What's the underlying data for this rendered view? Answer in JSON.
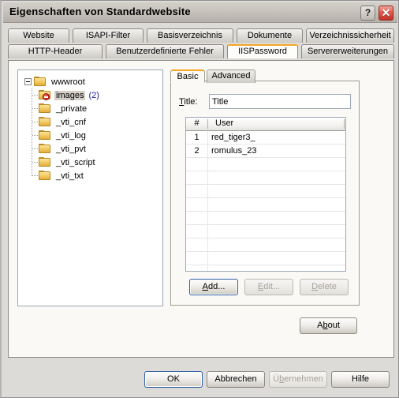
{
  "window": {
    "title": "Eigenschaften von Standardwebsite",
    "help_button": "?",
    "close_button": "✕"
  },
  "colors": {
    "accent_orange": "#f5a623",
    "dialog_face": "#dcdbd8",
    "panel_background": "#faf9f5",
    "tree_count_blue": "#1a1aa8",
    "selection_gray": "#d4d0c8",
    "close_red": "#c23227"
  },
  "outer_tabs": {
    "row1": [
      {
        "label": "Website",
        "active": false
      },
      {
        "label": "ISAPI-Filter",
        "active": false
      },
      {
        "label": "Basisverzeichnis",
        "active": false
      },
      {
        "label": "Dokumente",
        "active": false
      },
      {
        "label": "Verzeichnissicherheit",
        "active": false
      }
    ],
    "row2": [
      {
        "label": "HTTP-Header",
        "active": false
      },
      {
        "label": "Benutzerdefinierte Fehler",
        "active": false
      },
      {
        "label": "IISPassword",
        "active": true
      },
      {
        "label": "Servererweiterungen",
        "active": false
      }
    ]
  },
  "tree": {
    "root": {
      "label": "wwwroot",
      "expanded": true,
      "icon": "folder-icon"
    },
    "children": [
      {
        "label": "images",
        "count": "(2)",
        "selected": true,
        "icon": "folder-denied-icon"
      },
      {
        "label": "_private",
        "count": "",
        "selected": false,
        "icon": "folder-icon"
      },
      {
        "label": "_vti_cnf",
        "count": "",
        "selected": false,
        "icon": "folder-icon"
      },
      {
        "label": "_vti_log",
        "count": "",
        "selected": false,
        "icon": "folder-icon"
      },
      {
        "label": "_vti_pvt",
        "count": "",
        "selected": false,
        "icon": "folder-icon"
      },
      {
        "label": "_vti_script",
        "count": "",
        "selected": false,
        "icon": "folder-icon"
      },
      {
        "label": "_vti_txt",
        "count": "",
        "selected": false,
        "icon": "folder-icon"
      }
    ]
  },
  "inner_tabs": [
    {
      "label": "Basic",
      "active": true
    },
    {
      "label": "Advanced",
      "active": false
    }
  ],
  "title_field": {
    "label": "Title:",
    "label_accel": "T",
    "value": "Title",
    "placeholder": ""
  },
  "grid": {
    "columns": [
      "#",
      "User"
    ],
    "rows": [
      {
        "num": "1",
        "user": "red_tiger3_"
      },
      {
        "num": "2",
        "user": "romulus_23"
      }
    ],
    "empty_row_count": 10
  },
  "panel_buttons": {
    "add": {
      "label": "Add...",
      "accel": "A",
      "enabled": true,
      "default": true
    },
    "edit": {
      "label": "Edit...",
      "accel": "E",
      "enabled": false,
      "default": false
    },
    "delete": {
      "label": "Delete",
      "accel": "D",
      "enabled": false,
      "default": false
    },
    "about": {
      "label": "About",
      "accel": "b",
      "enabled": true,
      "default": false
    }
  },
  "dialog_buttons": [
    {
      "label": "OK",
      "enabled": true,
      "default": true
    },
    {
      "label": "Abbrechen",
      "enabled": true,
      "default": false
    },
    {
      "label": "Übernehmen",
      "enabled": false,
      "default": false
    },
    {
      "label": "Hilfe",
      "enabled": true,
      "default": false
    }
  ]
}
